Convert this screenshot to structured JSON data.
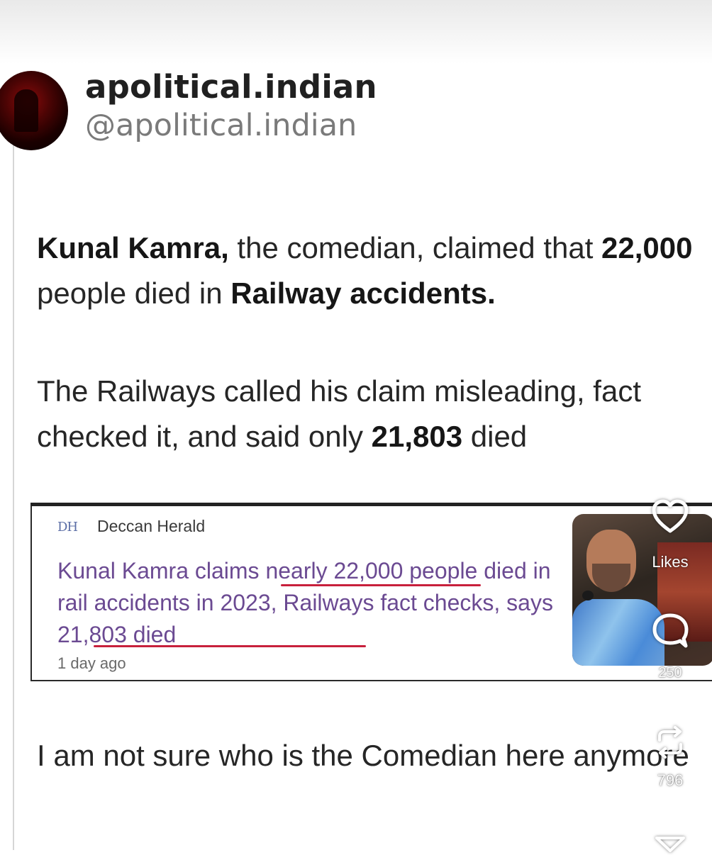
{
  "post": {
    "display_name": "apolitical.indian",
    "handle": "@apolitical.indian",
    "paragraph1": [
      {
        "text": "Kunal Kamra,",
        "bold": true
      },
      {
        "text": " the comedian, claimed that ",
        "bold": false
      },
      {
        "text": "22,000",
        "bold": true
      },
      {
        "text": " people died in ",
        "bold": false
      },
      {
        "text": "Railway accidents.",
        "bold": true
      }
    ],
    "paragraph2": [
      {
        "text": "The Railways called his claim misleading, fact checked it, and said only ",
        "bold": false
      },
      {
        "text": "21,803",
        "bold": true
      },
      {
        "text": " died",
        "bold": false
      }
    ],
    "paragraph3": "I am not sure who is the Comedian here anymore"
  },
  "news_card": {
    "source_logo": "DH",
    "source_name": "Deccan Herald",
    "headline": "Kunal Kamra claims nearly 22,000 people died in rail accidents in 2023, Railways fact checks, says 21,803 died",
    "age": "1 day ago",
    "underline_color": "#c8203c",
    "headline_color": "#6b4a92"
  },
  "actions": {
    "likes_label": "Likes",
    "comments_count": "250",
    "reposts_count": "796"
  }
}
